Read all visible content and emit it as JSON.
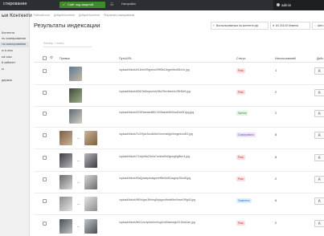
{
  "app": {
    "title": "стирование"
  },
  "topbar": {
    "run_button_label": "Сайт под защитой",
    "notifications_label": "Настройки",
    "admin_label": "admin"
  },
  "sidebar": {
    "brand": "ыи Контенти",
    "items": [
      {
        "label": "Контенти"
      },
      {
        "label": "ль сканирования"
      },
      {
        "label": "ты сканирования"
      },
      {
        "label": "ы и кэш"
      },
      {
        "label": "ые кэш"
      },
      {
        "label": "й кабинет"
      },
      {
        "label": "ы"
      },
      {
        "label": "держка"
      }
    ]
  },
  "breadcrumb": [
    "Рабочий стол",
    "Добрый Контенти",
    "Добрый Контенти",
    "Результаты сканирования"
  ],
  "page": {
    "title": "Результаты индексации"
  },
  "header": {
    "site_box": "Воспользоваться на контенте.рф",
    "balance_box": "84 215,00 Кемена",
    "extra_box": "Авто"
  },
  "filter": {
    "placeholder": "Фильтр + поиск"
  },
  "table": {
    "columns": {
      "preview": "Превью",
      "path": "Путь/URL",
      "status": "Статус",
      "used": "Использований",
      "actions": "Дейс"
    },
    "rows": [
      {
        "path": "/upload/iblock/e14/ee0f9ypeso0990bd1bjyee8sr6f1e1n.jpg",
        "status": "Риск",
        "used": "1",
        "action": "Д",
        "thumb": "single"
      },
      {
        "path": "/upload/iblock/006/1b8mpxorxlv35e29enIbee4x2f9rf2e5.jpg",
        "status": "Риск",
        "used": "2",
        "action": "Д",
        "thumb": "single"
      },
      {
        "path": "/upload/iblock/675/f4aeaed6821335a4ufn800sxd0w051jpg.jpg",
        "status": "Чистое",
        "used": "2",
        "action": "Д",
        "thumb": "single"
      },
      {
        "path": "/upload/iblock/7c2/9yzr3wo8d1m0unnmcfgn0eugmtzcd02.jpg",
        "status": "Сканировано",
        "used": "8",
        "action": "Д",
        "thumb": "pair"
      },
      {
        "path": "/upload/iblock/71d/pe8a23c0a7cmbs69x0gmrg6gl8vrr4.jpg",
        "status": "Риск",
        "used": "8",
        "action": "Д",
        "thumb": "pair"
      },
      {
        "path": "/upload/iblock/f0a/jywaquinaigunef9br6n8f1aqyup26ud8.jpg",
        "status": "Риск",
        "used": "2",
        "action": "Д",
        "thumb": "pair"
      },
      {
        "path": "/upload/iblock/9f0/nlgxc3tirhng3njagrudfnnkfIbe0mce2f9gh2.jpg",
        "status": "Заменено",
        "used": "6",
        "action": "Д",
        "thumb": "pair"
      },
      {
        "path": "/upload/iblock/fe0/1zcnyewvnm0ogOxb5sdewgn2215ab2zn.jpg",
        "status": "Риск",
        "used": "2",
        "action": "Д",
        "thumb": "pair"
      }
    ]
  },
  "colors": {
    "topbar": "#2b2f33",
    "green": "#3e8a2c",
    "risk_bg": "#f9e1e1",
    "risk_fg": "#c33",
    "clean_bg": "#e2f5e4",
    "clean_fg": "#2f8a3b",
    "scanned_bg": "#ece4f7",
    "scanned_fg": "#7b57b2",
    "replaced_bg": "#def0ff",
    "replaced_fg": "#2b74c4"
  }
}
